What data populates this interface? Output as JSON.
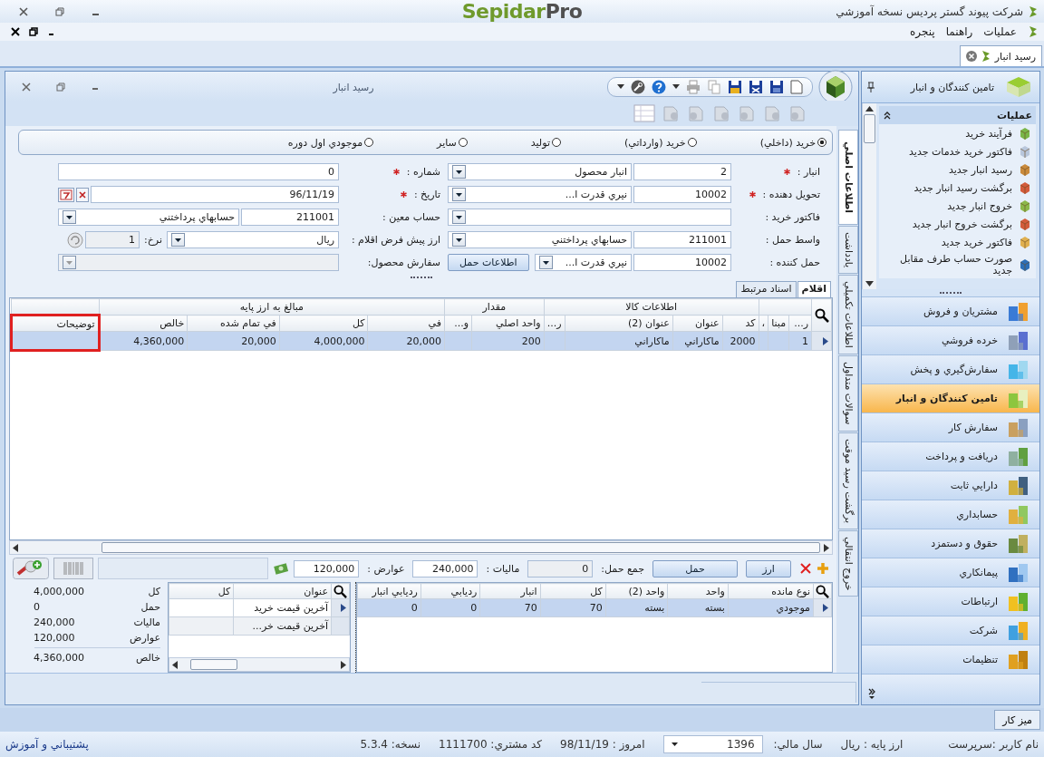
{
  "app": {
    "title": "شرکت پيوند گستر پرديس نسخه آموزشي",
    "logo": {
      "name": "Sepidar",
      "suffix": "Pro"
    }
  },
  "menu": [
    {
      "label": "عمليات"
    },
    {
      "label": "راهنما"
    },
    {
      "label": "پنجره"
    }
  ],
  "document_tabs": [
    {
      "label": "رسيد انبار",
      "selected": true
    }
  ],
  "window": {
    "title": "رسيد انبار"
  },
  "receipt_types": [
    {
      "label": "خريد (داخلي)",
      "selected": true
    },
    {
      "label": "خريد (وارداتي)",
      "selected": false
    },
    {
      "label": "توليد",
      "selected": false
    },
    {
      "label": "ساير",
      "selected": false
    },
    {
      "label": "موجودي اول دوره",
      "selected": false
    }
  ],
  "fields": [
    {
      "kind": "lookup",
      "label": "انبار :",
      "required": true,
      "code": "2",
      "name": "انبار محصول"
    },
    {
      "kind": "text",
      "label": "شماره :",
      "required": true,
      "value": "0"
    },
    {
      "kind": "lookup",
      "label": "تحويل دهنده :",
      "required": true,
      "code": "10002",
      "name": "نيري قدرت ا..."
    },
    {
      "kind": "date",
      "label": "تاريخ :",
      "required": true,
      "value": "96/11/19"
    },
    {
      "kind": "combo",
      "label": "فاکتور خريد :",
      "required": false,
      "disabled": false
    },
    {
      "kind": "lookup",
      "label": "حساب معين :",
      "required": false,
      "code": "211001",
      "name": "حسابهاي پرداختني"
    },
    {
      "kind": "lookup",
      "label": "واسط حمل :",
      "required": false,
      "code": "211001",
      "name": "حسابهاي پرداختني"
    },
    {
      "kind": "currency",
      "label": "ارز پيش فرض اقلام :",
      "required": false,
      "value": "ريال",
      "rate_label": "نرخ:",
      "rate": "1",
      "rate_disabled": true
    },
    {
      "kind": "lookup",
      "label": "حمل کننده :",
      "required": false,
      "code": "10002",
      "name": "نيري قدرت ا...",
      "button": "اطلاعات حمل"
    },
    {
      "kind": "combo",
      "label": "سفارش محصول:",
      "required": false,
      "disabled": true
    }
  ],
  "side_tabs": [
    {
      "label": "اطلاعات اصلي",
      "selected": true
    },
    {
      "label": "يادداشت",
      "selected": false
    },
    {
      "label": "اطلاعات تکميلي",
      "selected": false
    },
    {
      "label": "سوالات متداول",
      "selected": false
    },
    {
      "label": "برگشت رسيد موقت",
      "selected": false
    },
    {
      "label": "خروج انتقالي",
      "selected": false
    }
  ],
  "item_tabs": [
    {
      "label": "اقلام",
      "selected": true
    },
    {
      "label": "اسناد مرتبط",
      "selected": false
    }
  ],
  "items_table": {
    "bands": [
      {
        "columns": [
          {
            "label": "ر..."
          },
          {
            "label": "مبنا"
          },
          {
            "label": "،"
          }
        ]
      },
      {
        "label": "اطلاعات کالا",
        "columns": [
          {
            "label": "کد"
          },
          {
            "label": "عنوان"
          },
          {
            "label": "عنوان (2)"
          },
          {
            "label": "ر..."
          }
        ]
      },
      {
        "label": "مقدار",
        "columns": [
          {
            "label": "واحد اصلي"
          },
          {
            "label": "و..."
          }
        ]
      },
      {
        "label": "مبالغ به ارز پايه",
        "columns": [
          {
            "label": "في"
          },
          {
            "label": "کل"
          },
          {
            "label": "في تمام شده"
          },
          {
            "label": "خالص"
          }
        ]
      },
      {
        "columns": [
          {
            "label": "توضيحات",
            "highlighted": true
          }
        ]
      }
    ],
    "rows": [
      {
        "selected": true,
        "cells": [
          "1",
          null,
          null,
          "2000",
          "ماکاراني",
          "ماکاراني",
          null,
          "200",
          null,
          "20,000",
          "4,000,000",
          "20,000",
          "4,360,000",
          null
        ]
      }
    ]
  },
  "totals_bar": {
    "buttons": [
      {
        "label": "ارز"
      },
      {
        "label": "حمل"
      }
    ],
    "fields": [
      {
        "label": "جمع حمل:",
        "value": "0",
        "disabled": true
      },
      {
        "label": "ماليات :",
        "value": "240,000",
        "disabled": false
      },
      {
        "label": "عوارض :",
        "value": "120,000",
        "disabled": false
      }
    ]
  },
  "stock_table": {
    "columns": [
      "نوع مانده",
      "واحد",
      "واحد (2)",
      "کل",
      "انبار",
      "رديابي",
      "رديابي انبار"
    ],
    "rows": [
      {
        "selected": true,
        "cells": [
          "موجودي",
          "بسته",
          "بسته",
          "70",
          "70",
          "0",
          "0"
        ]
      }
    ]
  },
  "price_table": {
    "columns": [
      "عنوان",
      "کل"
    ],
    "rows": [
      {
        "selected": true,
        "cells": [
          "آخرين قيمت خريد",
          null
        ]
      },
      {
        "selected": false,
        "cells": [
          "آخرين قيمت خر...",
          null
        ]
      }
    ]
  },
  "summary": [
    {
      "label": "کل",
      "value": "4,000,000"
    },
    {
      "label": "حمل",
      "value": "0"
    },
    {
      "label": "ماليات",
      "value": "240,000"
    },
    {
      "label": "عوارض",
      "value": "120,000"
    },
    {
      "label": "خالص",
      "value": "4,360,000"
    }
  ],
  "sidebar": {
    "title": "تامين کنندگان و انبار",
    "section": {
      "title": "عمليات",
      "items": [
        {
          "label": "فرآيند خريد"
        },
        {
          "label": "فاکتور خريد خدمات جديد"
        },
        {
          "label": "رسيد انبار جديد"
        },
        {
          "label": "برگشت رسيد انبار جديد"
        },
        {
          "label": "خروج انبار جديد"
        },
        {
          "label": "برگشت خروج انبار جديد"
        },
        {
          "label": "فاکتور خريد جديد"
        },
        {
          "label": "صورت حساب طرف مقابل جديد"
        }
      ]
    },
    "modules": [
      {
        "label": "مشتريان و فروش",
        "selected": false
      },
      {
        "label": "خرده فروشي",
        "selected": false
      },
      {
        "label": "سفارش‌گيري و پخش",
        "selected": false
      },
      {
        "label": "تامين کنندگان و انبار",
        "selected": true
      },
      {
        "label": "سفارش کار",
        "selected": false
      },
      {
        "label": "دريافت و پرداخت",
        "selected": false
      },
      {
        "label": "دارايي ثابت",
        "selected": false
      },
      {
        "label": "حسابداري",
        "selected": false
      },
      {
        "label": "حقوق و دستمزد",
        "selected": false
      },
      {
        "label": "پيمانکاري",
        "selected": false
      },
      {
        "label": "ارتباطات",
        "selected": false
      },
      {
        "label": "شرکت",
        "selected": false
      },
      {
        "label": "تنظيمات",
        "selected": false
      }
    ]
  },
  "taskbar": [
    {
      "label": "ميز کار"
    }
  ],
  "status_bar": {
    "user": "نام کاربر :سرپرست",
    "currency": "ارز پايه : ريال",
    "fiscal_year_label": "سال مالي:",
    "fiscal_year": "1396",
    "today": "امروز : 98/11/19",
    "customer_code": "کد مشتري: 1111700",
    "version": "نسخه: 5.3.4",
    "support": "پشتيباني و آموزش"
  }
}
